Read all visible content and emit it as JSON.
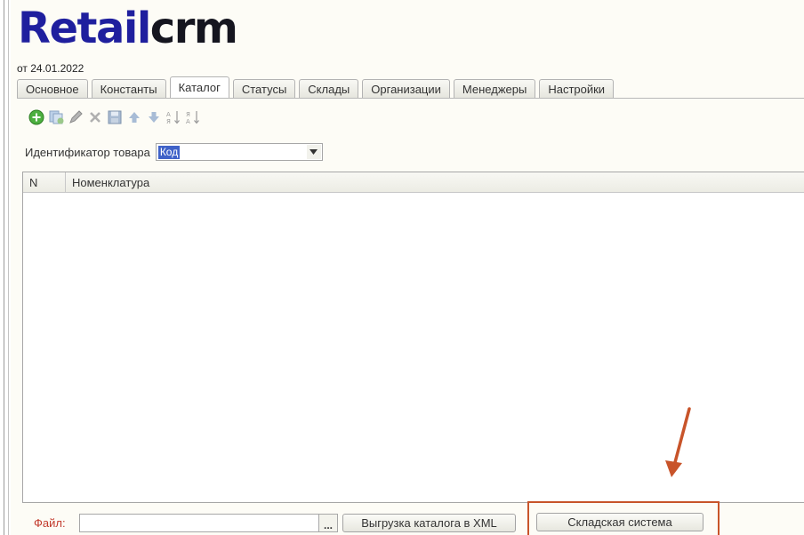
{
  "app": {
    "logo_r": "R",
    "logo_etail": "etail",
    "logo_crm": "crm",
    "version": "от 24.01.2022"
  },
  "tabs": [
    {
      "label": "Основное",
      "active": false
    },
    {
      "label": "Константы",
      "active": false
    },
    {
      "label": "Каталог",
      "active": true
    },
    {
      "label": "Статусы",
      "active": false
    },
    {
      "label": "Склады",
      "active": false
    },
    {
      "label": "Организации",
      "active": false
    },
    {
      "label": "Менеджеры",
      "active": false
    },
    {
      "label": "Настройки",
      "active": false
    }
  ],
  "toolbar": {
    "icons": [
      "add-icon",
      "copy-icon",
      "edit-icon",
      "delete-icon",
      "save-icon",
      "move-up-icon",
      "move-down-icon",
      "sort-ascending-icon",
      "sort-descending-icon"
    ]
  },
  "product_id": {
    "label": "Идентификатор товара",
    "value": "Код"
  },
  "grid": {
    "columns": [
      "N",
      "Номенклатура"
    ],
    "rows": []
  },
  "footer": {
    "file_label": "Файл:",
    "file_value": "",
    "browse_label": "...",
    "export_label": "Выгрузка каталога в XML",
    "warehouse_label": "Складская система"
  },
  "colors": {
    "logo_blue": "#1f1f9e",
    "logo_dark": "#15151f",
    "selection": "#3f62c8",
    "file_label": "#c23a2c",
    "annotation": "#c8542a"
  }
}
